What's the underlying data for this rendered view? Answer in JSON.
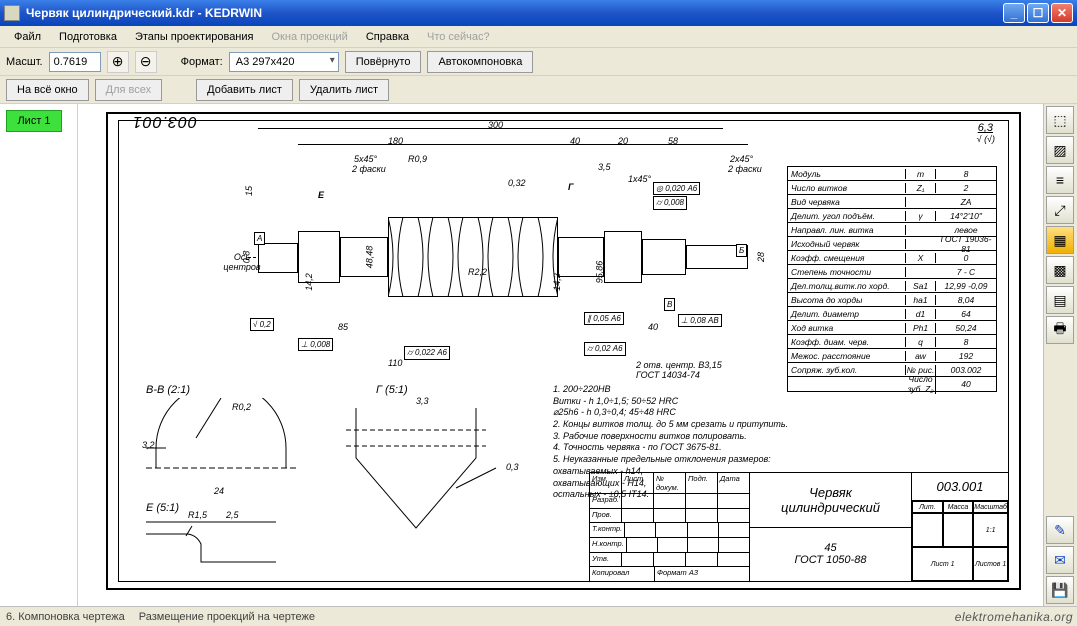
{
  "window": {
    "title": "Червяк цилиндрический.kdr - KEDRWIN"
  },
  "menu": {
    "file": "Файл",
    "prep": "Подготовка",
    "stages": "Этапы проектирования",
    "proj_windows": "Окна проекций",
    "help": "Справка",
    "whatnow": "Что сейчас?"
  },
  "toolbar": {
    "scale_label": "Масшт.",
    "scale_value": "0.7619",
    "format_label": "Формат:",
    "format_value": "А3  297x420",
    "rotated": "Повёрнуто",
    "autolayout": "Автокомпоновка",
    "fit_window": "На всё окно",
    "for_all": "Для всех",
    "add_sheet": "Добавить лист",
    "del_sheet": "Удалить лист"
  },
  "sheet_tab": "Лист 1",
  "drawing": {
    "number_top": "003.001",
    "ra": "6,3",
    "dims": {
      "total": "300",
      "l1": "180",
      "l2": "40",
      "l3": "20",
      "l4": "58",
      "ch1": "5x45°",
      "ch1note": "2 фаски",
      "ch2": "2x45°",
      "ch2note": "2 фаски",
      "r09": "R0,9",
      "r22": "R2,2",
      "d_small": "0,8",
      "d1": "14,2",
      "d2": "48,48",
      "d3": "14,2",
      "d4": "95,86",
      "d5": "28",
      "dim_15": "15",
      "dim_85": "85",
      "dim_110": "110",
      "dim_35": "3,5",
      "dim_40a": "40",
      "r145": "1x45°",
      "r032": "0,32",
      "ra02": "0,2",
      "tol1": "0,022  А6",
      "tol2": "0,008",
      "tol3": "0,05  А6",
      "tol4": "0,02  А6",
      "tol5": "0,020  А6",
      "tol6": "0,008",
      "tol7": "0,08  АВ",
      "note_centers": "2 отв. центр. В3,15\nГОСТ 14034-74",
      "axis_label": "Ось\nцентров",
      "markA": "А",
      "markB": "Б",
      "markE": "Е",
      "markG": "Г"
    },
    "detail_bb": "В-В  (2:1)",
    "detail_e": "Е  (5:1)",
    "detail_g": "Г  (5:1)",
    "detail_dims": {
      "bb_32": "3,2",
      "bb_24": "24",
      "bb_r02": "R0,2",
      "e_r15": "R1,5",
      "e_25": "2,5",
      "g_33": "3,3",
      "g_03": "0,3"
    },
    "params": [
      [
        "Модуль",
        "m",
        "8"
      ],
      [
        "Число витков",
        "Z₁",
        "2"
      ],
      [
        "Вид червяка",
        "",
        "ZA"
      ],
      [
        "Делит. угол подъём.",
        "γ",
        "14°2'10\""
      ],
      [
        "Направл. лин. витка",
        "",
        "левое"
      ],
      [
        "Исходный червяк",
        "",
        "ГОСТ 19036-81"
      ],
      [
        "Коэфф. смещения",
        "X",
        "0"
      ],
      [
        "Степень точности",
        "",
        "7 - C"
      ],
      [
        "Дел.толщ.витк.по хорд.",
        "Sa1",
        "12,99 -0,09"
      ],
      [
        "Высота до хорды",
        "ha1",
        "8,04"
      ],
      [
        "Делит. диаметр",
        "d1",
        "64"
      ],
      [
        "Ход витка",
        "Ph1",
        "50,24"
      ],
      [
        "Коэфф. диам. черв.",
        "q",
        "8"
      ],
      [
        "Межос. расстояние",
        "aw",
        "192"
      ],
      [
        "Сопряж. зуб.кол.",
        "№ рис.",
        "003.002"
      ],
      [
        "",
        "Число зуб. Z₂",
        "40"
      ]
    ],
    "notes": [
      "1. 200÷220НВ",
      "   Витки - h 1,0÷1,5; 50÷52 HRC",
      "   ⌀25h6 - h 0,3÷0,4; 45÷48 HRC",
      "2. Концы витков толщ. до 5 мм срезать и притупить.",
      "3. Рабочие поверхности витков полировать.",
      "4. Точность червяка - по ГОСТ 3675-81.",
      "5. Неуказанные предельные отклонения размеров:",
      "   охватываемых - h14,",
      "   охватывающих - H14,",
      "   остальных - ±0,5 IT14."
    ],
    "titleblock": {
      "name_line1": "Червяк",
      "name_line2": "цилиндрический",
      "material": "45\nГОСТ 1050-88",
      "number": "003.001",
      "scale": "1:1",
      "lit": "Лит.",
      "mass": "Масса",
      "msht": "Масштаб",
      "sheet": "Лист 1",
      "sheets": "Листов 1",
      "format": "Формат А3",
      "cells": [
        "Изм.",
        "Лист",
        "№ докум.",
        "Подп.",
        "Дата",
        "Разраб.",
        "Пров.",
        "Т.контр.",
        "Н.контр.",
        "Утв.",
        "Копировал"
      ]
    }
  },
  "status": {
    "step": "6. Компоновка чертежа",
    "hint": "Размещение проекций на чертеже"
  },
  "watermark": "elektromehanika.org",
  "icons": {
    "zoom_in": "⊕",
    "zoom_out": "⊖"
  }
}
